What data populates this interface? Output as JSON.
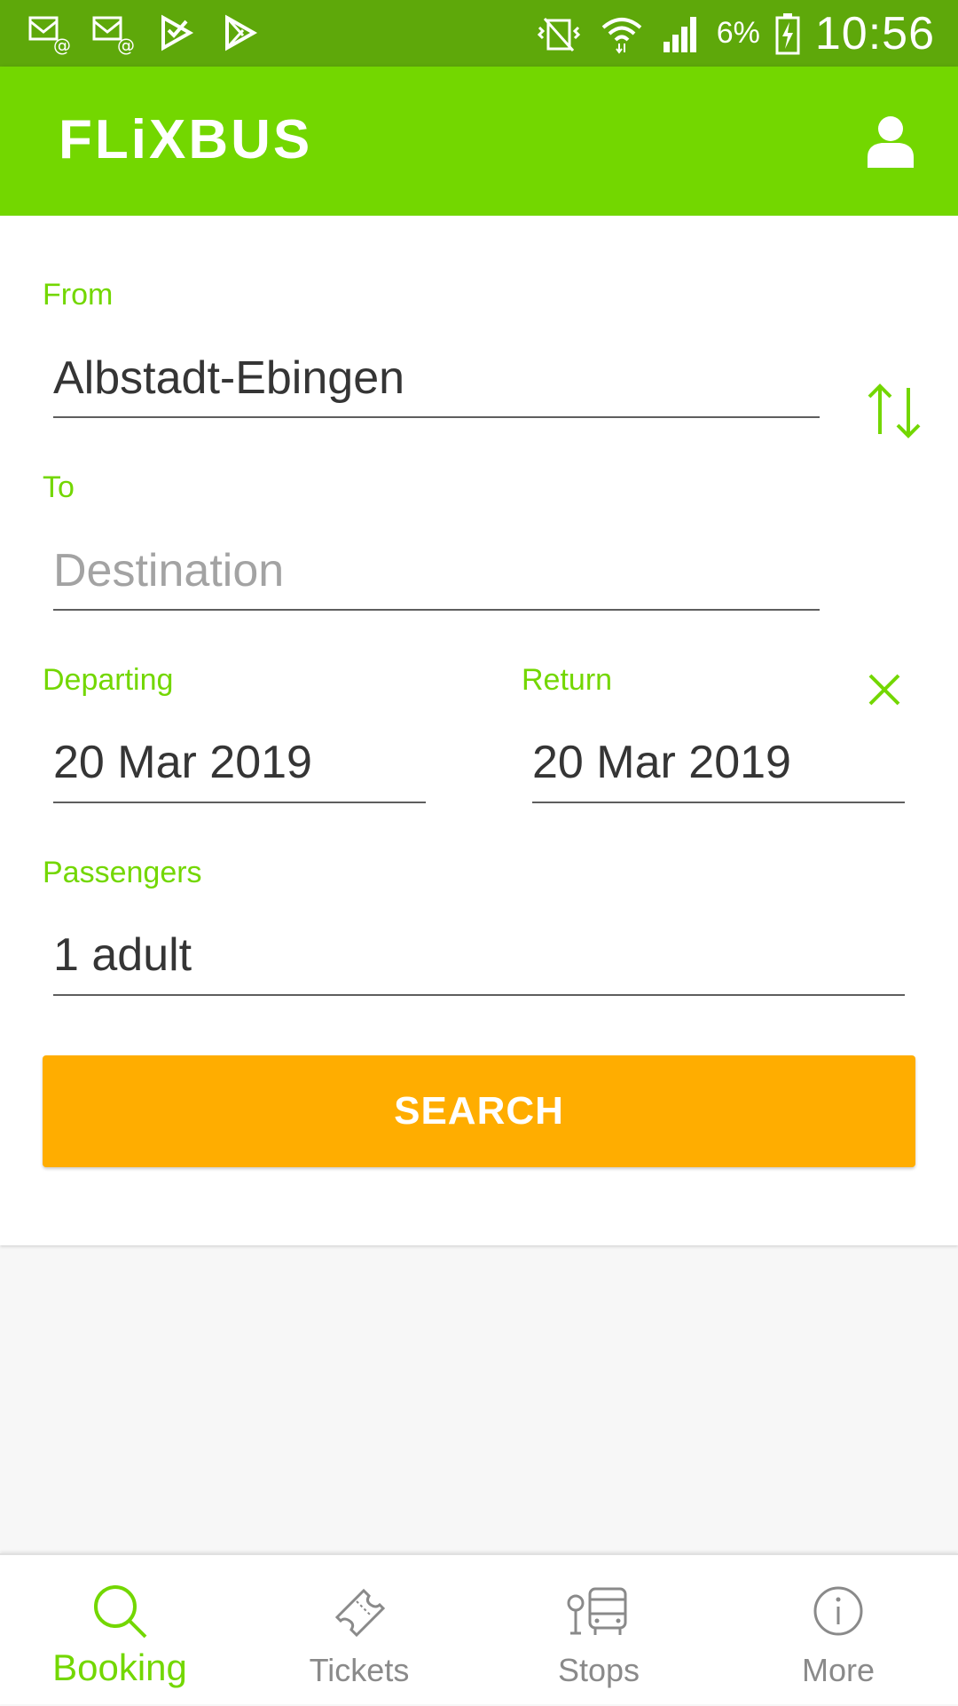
{
  "status_bar": {
    "battery_percent": "6%",
    "time": "10:56",
    "icons": [
      "email-icon",
      "email-icon",
      "play-store-icon",
      "play-store-icon",
      "vibrate-icon",
      "wifi-icon",
      "signal-icon",
      "battery-charging-icon"
    ]
  },
  "app_bar": {
    "logo": "FLiXBUS",
    "account_icon": "person-icon"
  },
  "form": {
    "from_label": "From",
    "from_value": "Albstadt-Ebingen",
    "to_label": "To",
    "to_placeholder": "Destination",
    "departing_label": "Departing",
    "departing_value": "20 Mar 2019",
    "return_label": "Return",
    "return_value": "20 Mar 2019",
    "passengers_label": "Passengers",
    "passengers_value": "1 adult",
    "search_button": "SEARCH"
  },
  "bottom_nav": {
    "items": [
      {
        "label": "Booking",
        "icon": "search-icon",
        "active": true
      },
      {
        "label": "Tickets",
        "icon": "ticket-icon",
        "active": false
      },
      {
        "label": "Stops",
        "icon": "bus-stop-icon",
        "active": false
      },
      {
        "label": "More",
        "icon": "info-icon",
        "active": false
      }
    ]
  },
  "colors": {
    "status_bar": "#5ea80a",
    "brand_green": "#73d700",
    "search_orange": "#ffad00",
    "text_dark": "#353535",
    "nav_inactive": "#8a8a8a"
  }
}
